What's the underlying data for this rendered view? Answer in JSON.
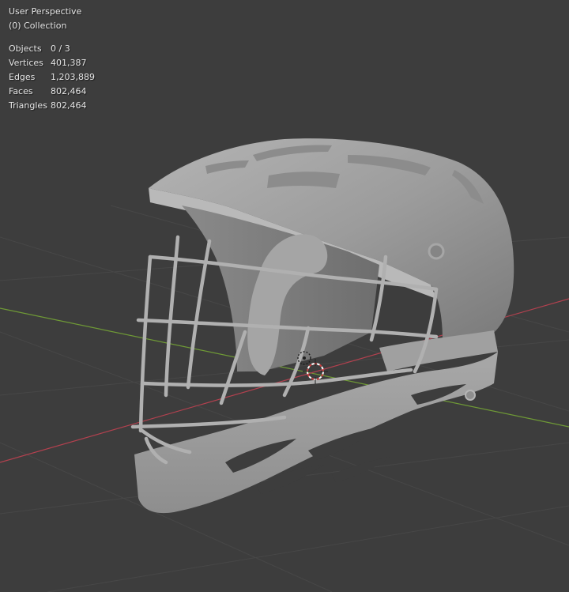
{
  "viewport": {
    "view_name": "User Perspective",
    "collection_label": "(0) Collection",
    "background_color": "#3d3d3d",
    "x_axis_color": "#b3414f",
    "y_axis_color": "#6f9a36",
    "model_color": "#9a9a9a",
    "gizmo": [
      "3d-cursor-icon",
      "object-origin-icon"
    ]
  },
  "stats": [
    {
      "label": "Objects",
      "value": "0 / 3"
    },
    {
      "label": "Vertices",
      "value": "401,387"
    },
    {
      "label": "Edges",
      "value": "1,203,889"
    },
    {
      "label": "Faces",
      "value": "802,464"
    },
    {
      "label": "Triangles",
      "value": "802,464"
    }
  ]
}
